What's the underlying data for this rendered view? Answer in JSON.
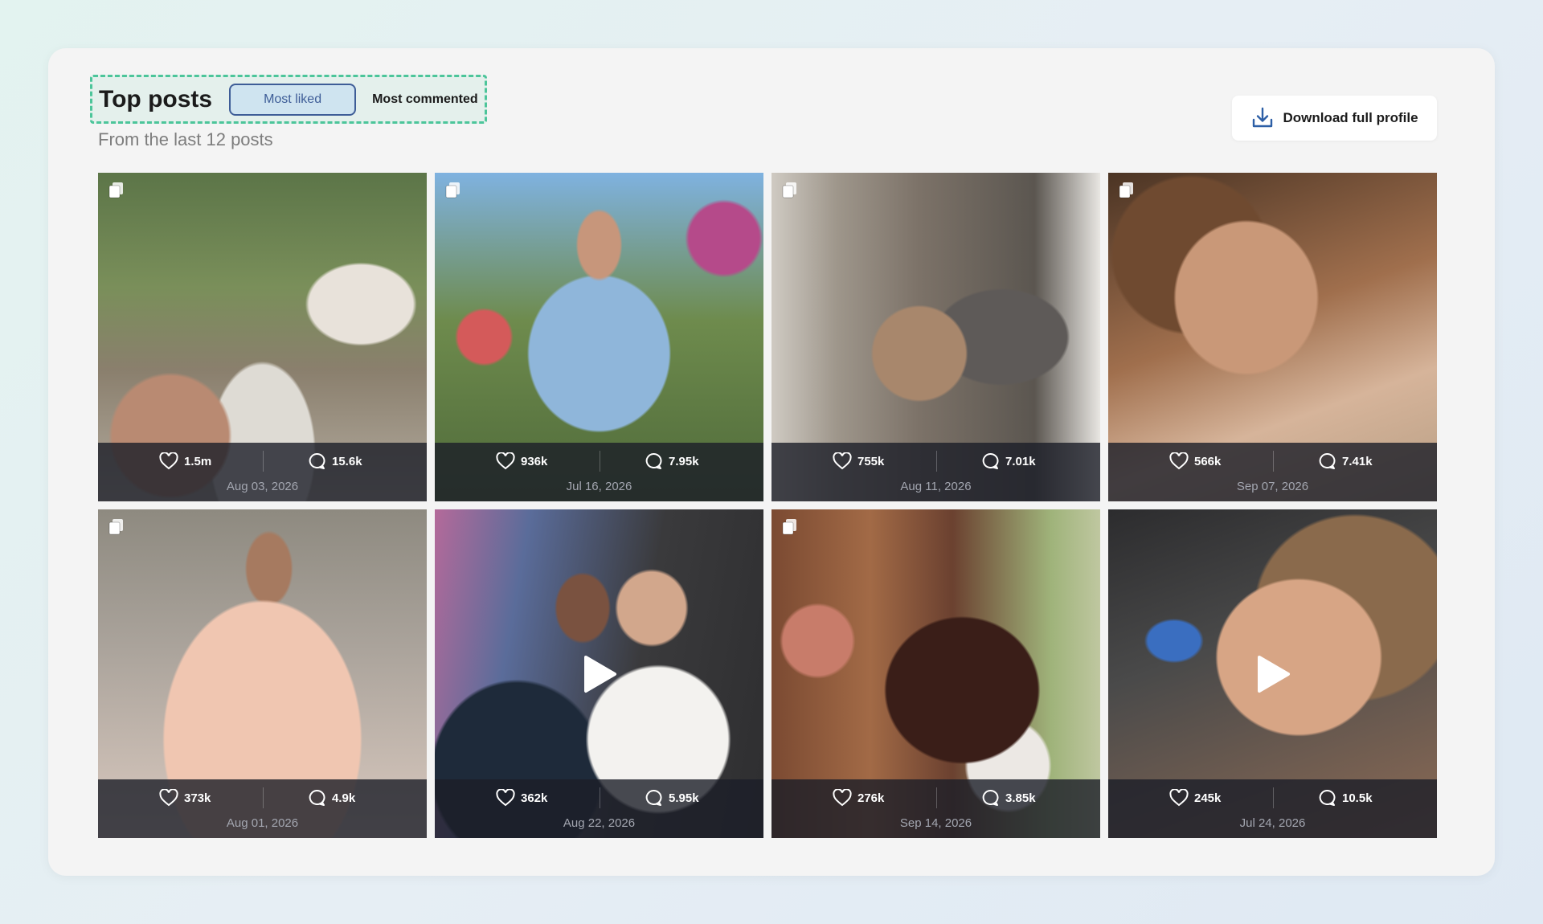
{
  "header": {
    "title": "Top posts",
    "tabs": [
      {
        "label": "Most liked",
        "active": true
      },
      {
        "label": "Most commented",
        "active": false
      }
    ],
    "subtitle": "From the last 12 posts",
    "download_label": "Download full profile"
  },
  "colors": {
    "accent": "#3e5d97",
    "highlight_border": "#4cc59a",
    "overlay": "#1c1e28"
  },
  "posts": [
    {
      "likes": "1.5m",
      "comments": "15.6k",
      "date": "Aug 03, 2026",
      "type": "carousel"
    },
    {
      "likes": "936k",
      "comments": "7.95k",
      "date": "Jul 16, 2026",
      "type": "carousel"
    },
    {
      "likes": "755k",
      "comments": "7.01k",
      "date": "Aug 11, 2026",
      "type": "carousel"
    },
    {
      "likes": "566k",
      "comments": "7.41k",
      "date": "Sep 07, 2026",
      "type": "carousel"
    },
    {
      "likes": "373k",
      "comments": "4.9k",
      "date": "Aug 01, 2026",
      "type": "carousel"
    },
    {
      "likes": "362k",
      "comments": "5.95k",
      "date": "Aug 22, 2026",
      "type": "video"
    },
    {
      "likes": "276k",
      "comments": "3.85k",
      "date": "Sep 14, 2026",
      "type": "carousel"
    },
    {
      "likes": "245k",
      "comments": "10.5k",
      "date": "Jul 24, 2026",
      "type": "video"
    }
  ],
  "icons": {
    "like": "heart-icon",
    "comment": "comment-icon",
    "download": "download-icon",
    "carousel": "multi-image-icon",
    "video": "play-icon"
  }
}
